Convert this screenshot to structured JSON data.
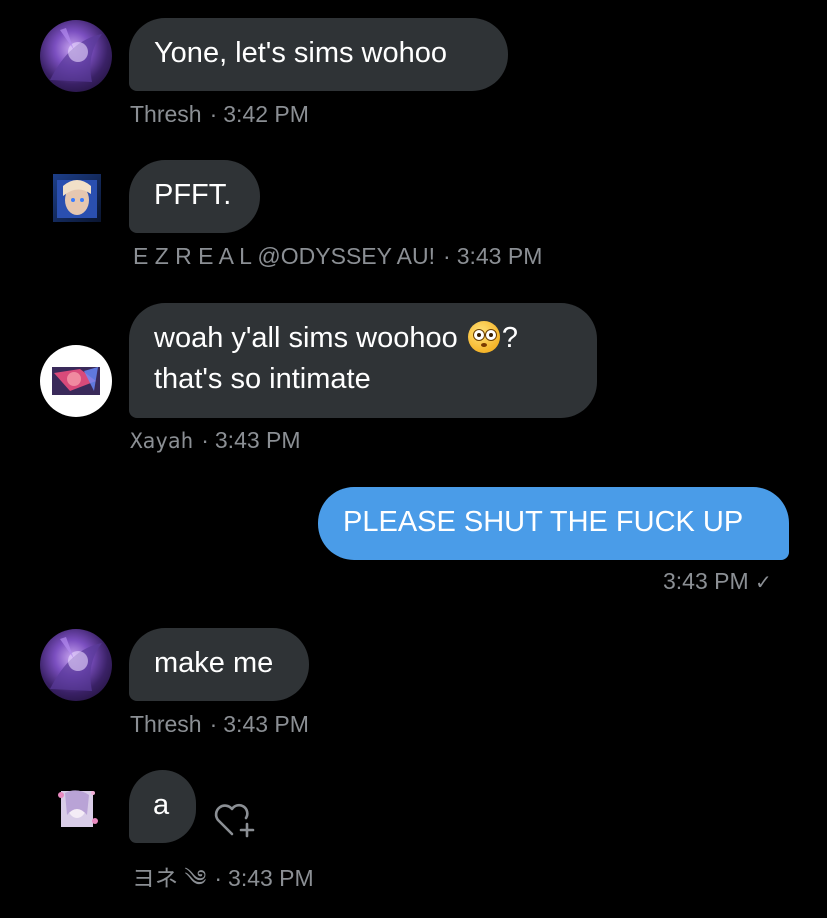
{
  "messages": [
    {
      "text": "Yone, let's sims wohoo",
      "sender": "Thresh",
      "time": "3:42 PM"
    },
    {
      "text": "PFFT.",
      "sender": "E Z R E A L @ODYSSEY AU!",
      "time": "3:43 PM"
    },
    {
      "text_line1": "woah y'all sims woohoo",
      "text_after_emoji": "?",
      "text_line2": "that's so intimate",
      "sender": "Xayah",
      "time": "3:43 PM"
    },
    {
      "text": "PLEASE SHUT THE FUCK UP",
      "time": "3:43 PM",
      "status": "✓"
    },
    {
      "text": "make me",
      "sender": "Thresh",
      "time": "3:43 PM"
    },
    {
      "text": "a",
      "sender": "ヨネ ༄",
      "time": "3:43 PM"
    }
  ],
  "separator": "·",
  "icons": {
    "flushed_emoji": "flushed-face-emoji",
    "react": "heart-plus-icon"
  },
  "colors": {
    "background": "#000000",
    "incoming_bubble": "#2f3336",
    "outgoing_bubble": "#4a9ce8",
    "meta_text": "#8b8f94"
  }
}
